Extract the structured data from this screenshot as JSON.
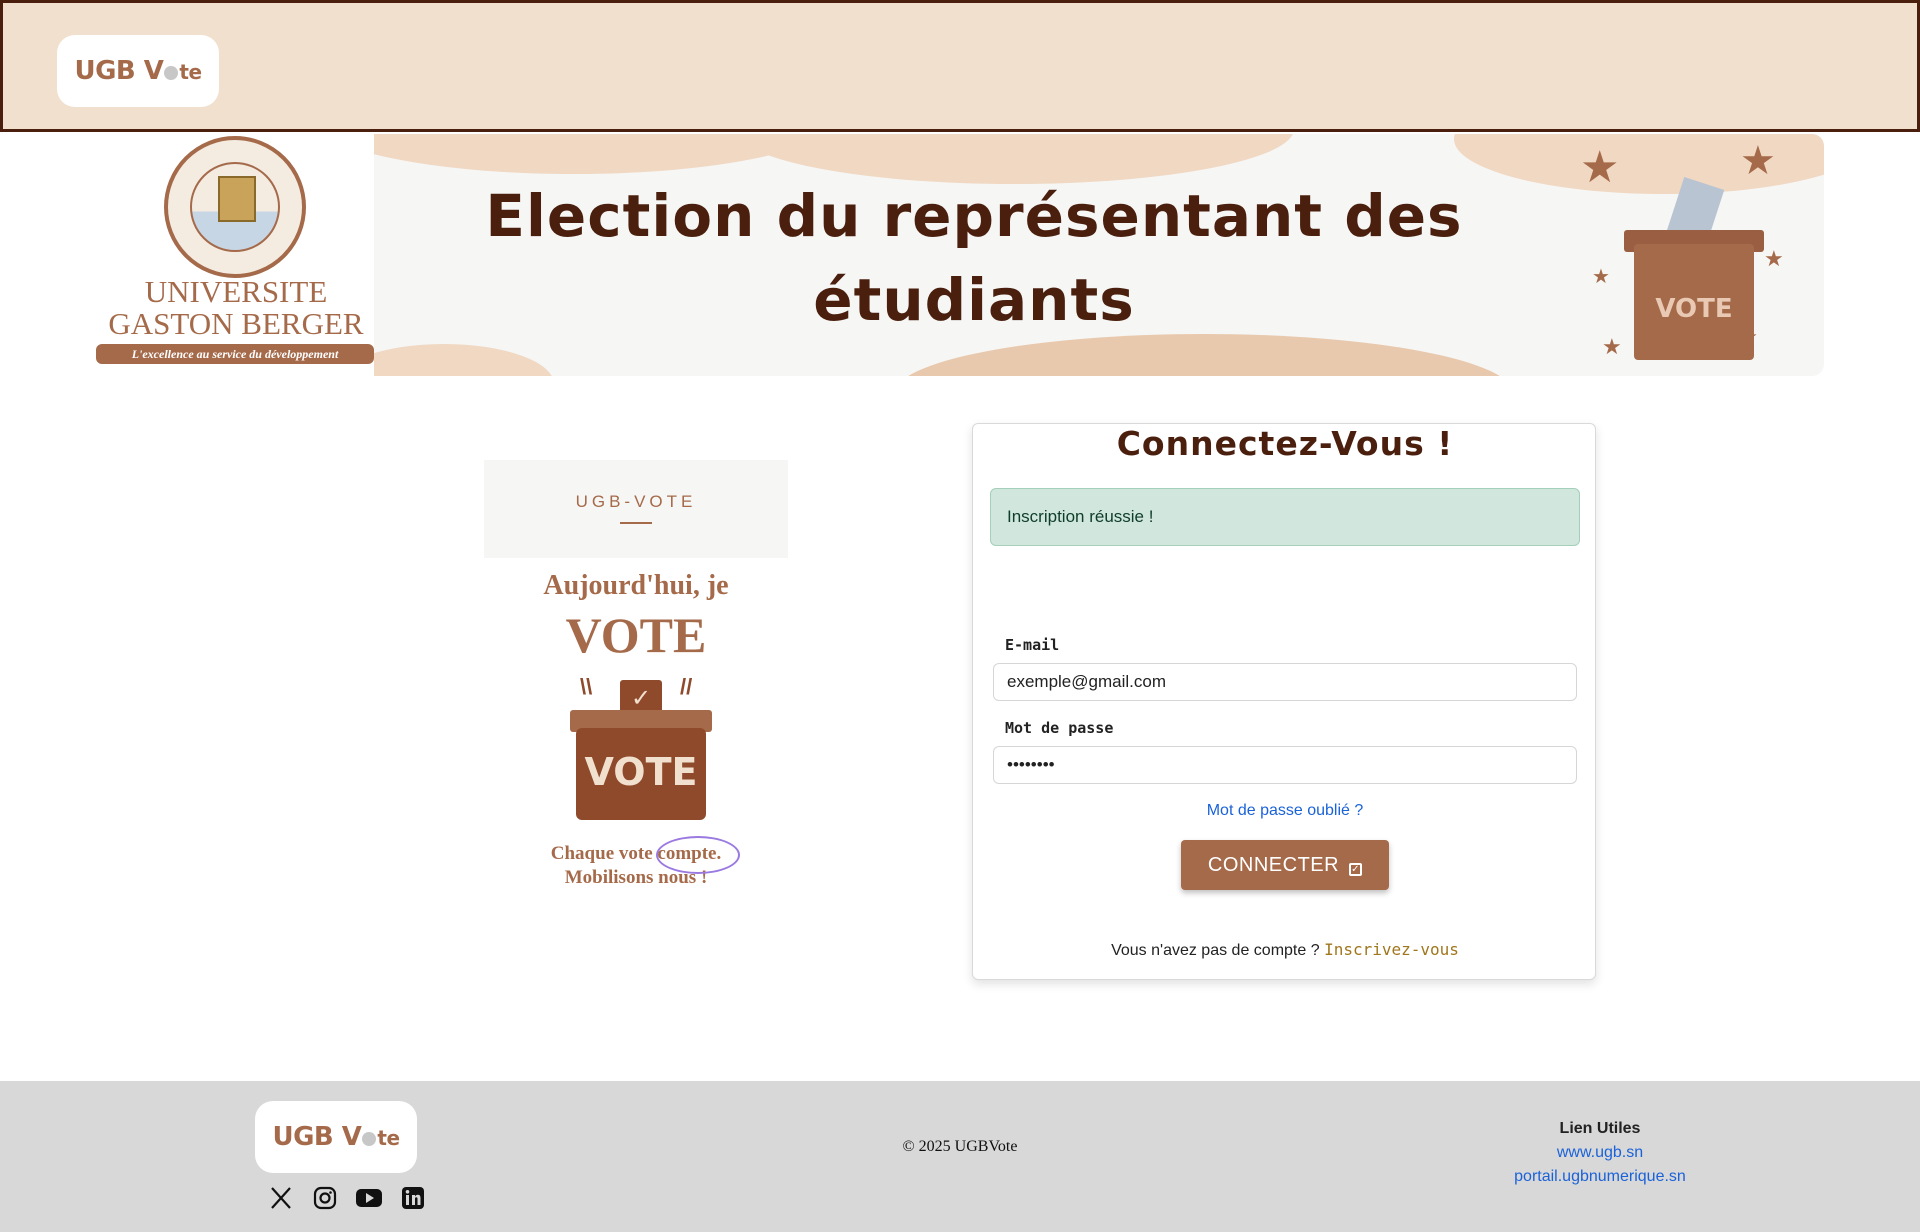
{
  "header": {
    "logo_main": "UGB V",
    "logo_tail": "te"
  },
  "banner": {
    "univ_line1": "UNIVERSITE",
    "univ_line2": "GASTON BERGER",
    "univ_tagline": "L'excellence au service du développement",
    "title_line1": "Election du représentant des",
    "title_line2": "étudiants",
    "ballot_label": "VOTE"
  },
  "promo": {
    "brand": "UGB-VOTE",
    "line1": "Aujourd'hui, je",
    "line2": "VOTE",
    "box_label": "VOTE",
    "line3": "Chaque vote compte.",
    "line4": "Mobilisons nous !"
  },
  "login": {
    "title": "Connectez-Vous !",
    "alert": "Inscription réussie !",
    "email_label": "E-mail",
    "email_value": "exemple@gmail.com",
    "password_label": "Mot de passe",
    "password_value": "••••••••",
    "forgot": "Mot de passe oublié ?",
    "submit": "CONNECTER",
    "no_account": "Vous n'avez pas de compte ?",
    "signup": "Inscrivez-vous"
  },
  "footer": {
    "copyright": "© 2025 UGBVote",
    "links_title": "Lien Utiles",
    "link1": "www.ugb.sn",
    "link2": "portail.ugbnumerique.sn",
    "socials": [
      "x-icon",
      "instagram-icon",
      "youtube-icon",
      "linkedin-icon"
    ]
  },
  "colors": {
    "brand_brown": "#a56a4a",
    "dark_brown": "#4a1f0e",
    "header_bg": "#f2e0cf",
    "alert_bg": "#d1e7dd",
    "link_blue": "#1a62d9"
  }
}
